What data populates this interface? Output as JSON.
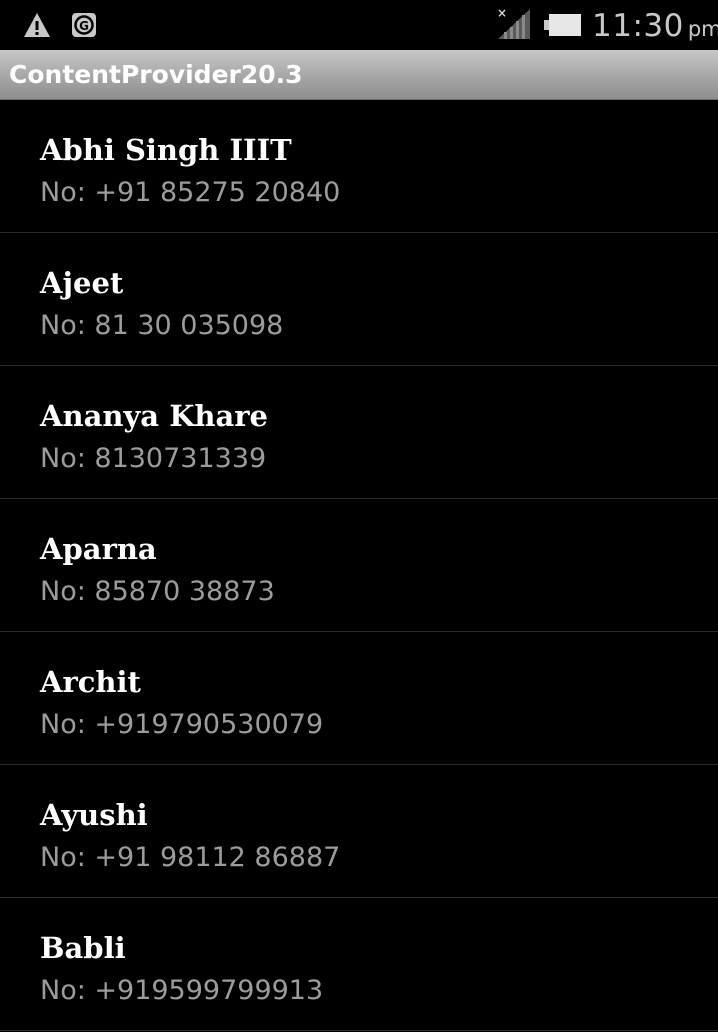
{
  "status_bar": {
    "icons": [
      "warning-icon",
      "g-app-icon",
      "signal-icon",
      "battery-icon"
    ],
    "time": "11:30",
    "ampm": "pm"
  },
  "app": {
    "title": "ContentProvider20.3"
  },
  "contacts": [
    {
      "name": "Abhi Singh IIIT",
      "number": "No: +91 85275 20840"
    },
    {
      "name": "Ajeet",
      "number": "No: 81 30 035098"
    },
    {
      "name": "Ananya Khare",
      "number": "No: 8130731339"
    },
    {
      "name": "Aparna",
      "number": "No: 85870 38873"
    },
    {
      "name": "Archit",
      "number": "No: +919790530079"
    },
    {
      "name": "Ayushi",
      "number": "No: +91 98112 86887"
    },
    {
      "name": "Babli",
      "number": "No: +919599799913"
    }
  ],
  "colors": {
    "background": "#000000",
    "title_bar": "#a9a9a9",
    "name_text": "#ffffff",
    "number_text": "#9c9c9c"
  }
}
